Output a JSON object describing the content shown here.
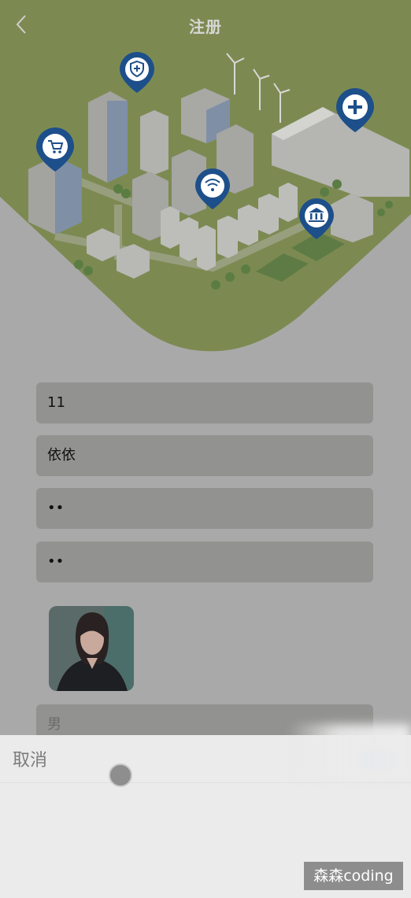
{
  "header": {
    "title": "注册",
    "back_icon": "chevron-left-icon"
  },
  "hero": {
    "pins": [
      "cart-icon",
      "shield-plus-icon",
      "wifi-icon",
      "bank-icon",
      "medical-plus-icon"
    ],
    "colors": {
      "ground": "#7c8a52",
      "pin": "#1d4f8a"
    }
  },
  "form": {
    "phone_value": "11",
    "nickname_value": "依依",
    "password_value": "••",
    "confirm_password_value": "••",
    "gender_placeholder": "男"
  },
  "sheet": {
    "cancel_label": "取消",
    "confirm_label": "确定"
  },
  "watermark": "森森coding"
}
